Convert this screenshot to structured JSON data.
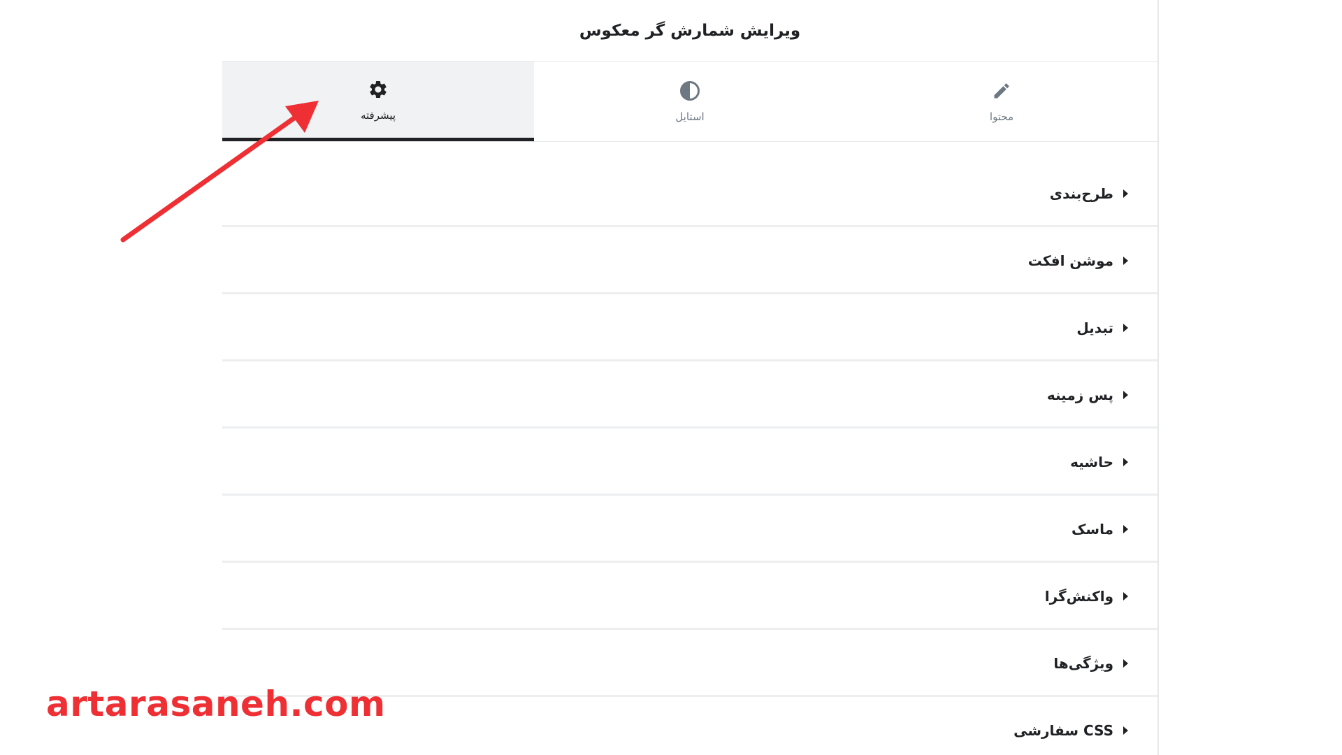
{
  "panel": {
    "title": "ویرایش شمارش گر معکوس"
  },
  "tabs": [
    {
      "label": "محتوا",
      "icon": "pencil-icon",
      "active": false
    },
    {
      "label": "استایل",
      "icon": "contrast-icon",
      "active": false
    },
    {
      "label": "پیشرفته",
      "icon": "gear-icon",
      "active": true
    }
  ],
  "sections": [
    {
      "label": "طرح‌بندی"
    },
    {
      "label": "موشن افکت"
    },
    {
      "label": "تبدیل"
    },
    {
      "label": "پس زمینه"
    },
    {
      "label": "حاشیه"
    },
    {
      "label": "ماسک"
    },
    {
      "label": "واکنش‌گرا"
    },
    {
      "label": "ویژگی‌ها"
    },
    {
      "label": "CSS سفارشی"
    }
  ],
  "annotation": {
    "arrow_color": "#ee3035",
    "watermark": "artarasaneh.com"
  },
  "colors": {
    "text": "#1f2124",
    "muted": "#6d7882",
    "active_tab_bg": "#f1f2f3",
    "divider": "#eceef0",
    "accent": "#ee3035"
  }
}
